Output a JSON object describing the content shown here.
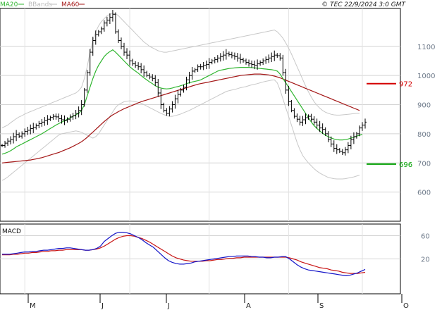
{
  "header": {
    "legend": [
      {
        "label": "MA20",
        "color": "#2fb52f"
      },
      {
        "label": "BBands",
        "color": "#bdbdbd"
      },
      {
        "label": "MA60",
        "color": "#a31515"
      }
    ],
    "copyright": "© TEC 22/9/2024 3:0 GMT"
  },
  "chart_data": [
    {
      "type": "ohlc",
      "title": "",
      "y_ticks": [
        1100,
        1000,
        900,
        800,
        700,
        600
      ],
      "ylim": [
        500,
        1230
      ],
      "x_ticks": [
        "M",
        "J",
        "J",
        "A",
        "S",
        "O"
      ],
      "grid": true,
      "levels": [
        {
          "label": "972",
          "value": 972,
          "color": "#d40000"
        },
        {
          "label": "696",
          "value": 696,
          "color": "#00a000"
        }
      ],
      "series": [
        {
          "name": "MA20",
          "color": "#2fb52f"
        },
        {
          "name": "BBands",
          "color": "#bdbdbd"
        },
        {
          "name": "MA60",
          "color": "#a31515"
        }
      ],
      "price": [
        760,
        768,
        775,
        780,
        790,
        798,
        792,
        800,
        808,
        812,
        818,
        822,
        828,
        835,
        840,
        845,
        850,
        856,
        860,
        858,
        852,
        848,
        845,
        850,
        858,
        862,
        870,
        880,
        900,
        950,
        1010,
        1080,
        1120,
        1140,
        1150,
        1160,
        1180,
        1190,
        1200,
        1210,
        1150,
        1120,
        1100,
        1080,
        1070,
        1050,
        1040,
        1035,
        1030,
        1020,
        1010,
        1000,
        995,
        990,
        975,
        940,
        900,
        880,
        870,
        885,
        900,
        920,
        935,
        950,
        960,
        985,
        1000,
        1015,
        1020,
        1030,
        1030,
        1035,
        1038,
        1045,
        1050,
        1055,
        1060,
        1065,
        1070,
        1075,
        1072,
        1068,
        1065,
        1060,
        1055,
        1050,
        1045,
        1040,
        1038,
        1035,
        1040,
        1045,
        1050,
        1055,
        1060,
        1065,
        1070,
        1068,
        1060,
        1010,
        950,
        910,
        880,
        860,
        850,
        840,
        848,
        855,
        860,
        850,
        840,
        830,
        820,
        815,
        800,
        780,
        765,
        750,
        745,
        740,
        735,
        745,
        760,
        780,
        790,
        800,
        820,
        830,
        840
      ],
      "ma20": [
        730,
        733,
        737,
        742,
        748,
        755,
        760,
        765,
        770,
        775,
        780,
        785,
        790,
        795,
        800,
        806,
        812,
        818,
        824,
        830,
        835,
        840,
        845,
        850,
        855,
        860,
        865,
        870,
        880,
        900,
        930,
        960,
        990,
        1015,
        1035,
        1050,
        1065,
        1075,
        1082,
        1088,
        1080,
        1070,
        1060,
        1050,
        1040,
        1030,
        1022,
        1015,
        1008,
        1000,
        992,
        985,
        978,
        972,
        965,
        960,
        957,
        955,
        954,
        955,
        957,
        960,
        962,
        965,
        968,
        972,
        975,
        978,
        980,
        982,
        985,
        990,
        995,
        1000,
        1005,
        1010,
        1015,
        1018,
        1020,
        1022,
        1024,
        1025,
        1026,
        1027,
        1028,
        1028,
        1028,
        1028,
        1027,
        1026,
        1025,
        1024,
        1023,
        1022,
        1021,
        1020,
        1018,
        1015,
        1005,
        990,
        975,
        960,
        945,
        930,
        915,
        900,
        885,
        870,
        855,
        840,
        828,
        818,
        810,
        802,
        795,
        790,
        786,
        782,
        780,
        779,
        779,
        780,
        782,
        785,
        788,
        792,
        795,
        798
      ],
      "ma60": [
        700,
        701,
        702,
        703,
        704,
        705,
        706,
        707,
        708,
        709,
        710,
        712,
        714,
        716,
        718,
        721,
        724,
        727,
        730,
        733,
        736,
        740,
        744,
        748,
        752,
        757,
        762,
        767,
        773,
        780,
        788,
        797,
        806,
        815,
        824,
        833,
        842,
        850,
        858,
        865,
        870,
        876,
        881,
        886,
        890,
        894,
        898,
        902,
        906,
        910,
        913,
        916,
        919,
        922,
        925,
        928,
        931,
        934,
        937,
        940,
        943,
        946,
        949,
        952,
        955,
        958,
        961,
        964,
        967,
        970,
        972,
        974,
        976,
        978,
        980,
        982,
        984,
        986,
        988,
        990,
        992,
        994,
        996,
        998,
        1000,
        1001,
        1002,
        1003,
        1004,
        1005,
        1005,
        1005,
        1004,
        1003,
        1002,
        1000,
        998,
        995,
        992,
        988,
        984,
        980,
        976,
        972,
        968,
        964,
        960,
        956,
        952,
        948,
        944,
        940,
        936,
        932,
        928,
        924,
        920,
        916,
        912,
        908,
        904,
        900,
        896,
        892,
        888,
        884,
        880
      ],
      "bb_upper": [
        820,
        825,
        830,
        838,
        845,
        852,
        858,
        862,
        868,
        872,
        876,
        880,
        884,
        888,
        892,
        896,
        900,
        904,
        908,
        912,
        916,
        920,
        924,
        928,
        932,
        936,
        940,
        948,
        960,
        990,
        1030,
        1080,
        1120,
        1150,
        1170,
        1185,
        1195,
        1205,
        1210,
        1213,
        1212,
        1205,
        1195,
        1185,
        1175,
        1165,
        1155,
        1145,
        1135,
        1125,
        1115,
        1108,
        1100,
        1095,
        1090,
        1085,
        1082,
        1080,
        1080,
        1082,
        1084,
        1086,
        1088,
        1090,
        1092,
        1094,
        1096,
        1098,
        1100,
        1102,
        1104,
        1106,
        1108,
        1110,
        1112,
        1114,
        1116,
        1118,
        1120,
        1122,
        1124,
        1126,
        1128,
        1130,
        1132,
        1134,
        1136,
        1138,
        1140,
        1142,
        1144,
        1146,
        1148,
        1150,
        1152,
        1154,
        1156,
        1150,
        1140,
        1128,
        1112,
        1094,
        1074,
        1052,
        1030,
        1008,
        986,
        964,
        944,
        926,
        910,
        898,
        888,
        880,
        874,
        870,
        867,
        865,
        864,
        864,
        865,
        866,
        867,
        868,
        869,
        870,
        870
      ],
      "bb_lower": [
        640,
        645,
        652,
        660,
        668,
        676,
        684,
        692,
        700,
        708,
        716,
        724,
        732,
        740,
        748,
        756,
        764,
        772,
        780,
        788,
        796,
        800,
        802,
        804,
        806,
        808,
        810,
        808,
        805,
        800,
        795,
        790,
        785,
        790,
        800,
        815,
        830,
        845,
        860,
        875,
        890,
        900,
        905,
        910,
        912,
        913,
        912,
        910,
        908,
        905,
        900,
        895,
        890,
        885,
        880,
        875,
        870,
        866,
        862,
        860,
        860,
        862,
        865,
        868,
        872,
        876,
        880,
        885,
        890,
        895,
        900,
        905,
        910,
        915,
        920,
        925,
        930,
        935,
        940,
        945,
        948,
        950,
        952,
        955,
        958,
        960,
        962,
        965,
        968,
        970,
        972,
        975,
        978,
        980,
        982,
        984,
        985,
        975,
        950,
        920,
        890,
        860,
        830,
        800,
        770,
        745,
        725,
        712,
        700,
        690,
        680,
        672,
        665,
        660,
        655,
        650,
        648,
        646,
        645,
        645,
        645,
        646,
        648,
        650,
        652,
        655,
        658
      ]
    },
    {
      "type": "line",
      "title": "MACD",
      "y_ticks": [
        60,
        20
      ],
      "ylim": [
        -40,
        80
      ],
      "x_ticks": [
        "M",
        "J",
        "J",
        "A",
        "S",
        "O"
      ],
      "grid": true,
      "series": [
        {
          "name": "MACD",
          "color": "#1414c8"
        },
        {
          "name": "Signal",
          "color": "#c81414"
        }
      ],
      "macd": [
        28,
        28,
        28,
        29,
        30,
        31,
        32,
        32,
        33,
        33,
        34,
        35,
        35,
        36,
        37,
        38,
        38,
        39,
        39,
        38,
        37,
        36,
        35,
        35,
        36,
        38,
        42,
        50,
        55,
        60,
        64,
        66,
        66,
        65,
        63,
        60,
        57,
        53,
        48,
        44,
        40,
        34,
        28,
        22,
        17,
        14,
        12,
        11,
        11,
        12,
        13,
        15,
        16,
        17,
        18,
        19,
        20,
        21,
        22,
        23,
        24,
        24,
        25,
        25,
        25,
        25,
        24,
        24,
        23,
        23,
        22,
        22,
        23,
        23,
        24,
        24,
        20,
        15,
        10,
        6,
        3,
        1,
        0,
        -1,
        -2,
        -3,
        -4,
        -5,
        -6,
        -7,
        -8,
        -9,
        -8,
        -6,
        -4,
        -1,
        2
      ],
      "signal": [
        27,
        27,
        27,
        28,
        28,
        29,
        30,
        30,
        31,
        31,
        32,
        33,
        33,
        34,
        34,
        35,
        35,
        36,
        36,
        36,
        36,
        36,
        35,
        35,
        36,
        37,
        39,
        42,
        46,
        50,
        54,
        57,
        59,
        60,
        60,
        59,
        57,
        55,
        52,
        49,
        45,
        41,
        37,
        33,
        29,
        25,
        22,
        20,
        18,
        17,
        16,
        16,
        16,
        16,
        17,
        17,
        18,
        19,
        19,
        20,
        21,
        21,
        22,
        22,
        23,
        23,
        23,
        23,
        23,
        23,
        23,
        23,
        23,
        23,
        23,
        23,
        22,
        20,
        18,
        15,
        13,
        11,
        9,
        7,
        5,
        4,
        3,
        1,
        0,
        -1,
        -3,
        -4,
        -5,
        -5,
        -5,
        -4,
        -3
      ]
    }
  ]
}
